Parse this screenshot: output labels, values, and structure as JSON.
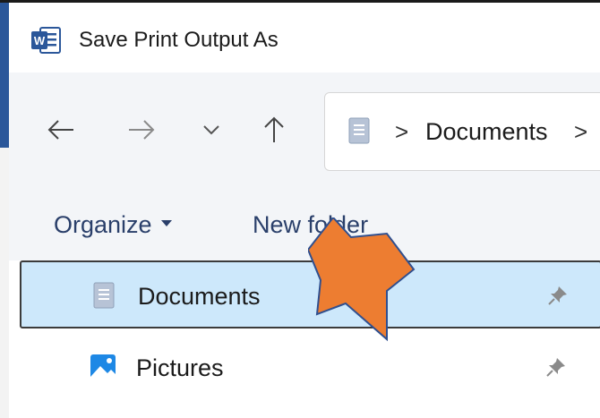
{
  "window": {
    "title": "Save Print Output As",
    "app_icon": "word-icon",
    "app_icon_letter": "W"
  },
  "nav": {
    "back_icon": "arrow-left-icon",
    "forward_icon": "arrow-right-icon",
    "recent_icon": "chevron-down-icon",
    "up_icon": "arrow-up-icon"
  },
  "address_bar": {
    "separator": ">",
    "segment": "Documents",
    "trailing_separator": ">"
  },
  "toolbar": {
    "organize_label": "Organize",
    "new_folder_label": "New folder"
  },
  "sidebar": {
    "items": [
      {
        "label": "Documents",
        "icon": "documents-icon",
        "selected": true,
        "pinned": true
      },
      {
        "label": "Pictures",
        "icon": "pictures-icon",
        "selected": false,
        "pinned": true
      }
    ]
  },
  "colors": {
    "selection_bg": "#cde8fb",
    "toolbar_text": "#2a3f6a",
    "annotation_arrow": "#ed7d31",
    "annotation_outline": "#2f4f8f",
    "word_blue": "#2b579a"
  }
}
